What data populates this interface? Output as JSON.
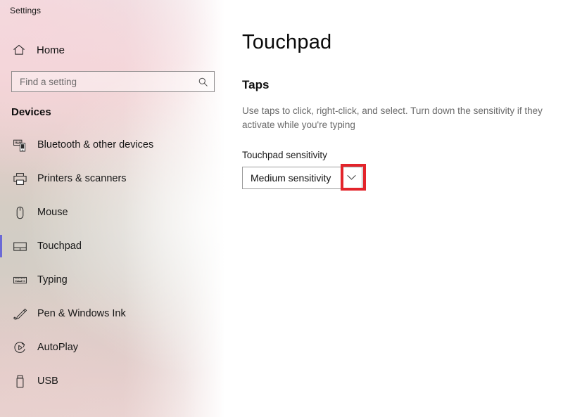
{
  "window": {
    "app_title": "Settings"
  },
  "sidebar": {
    "home": {
      "label": "Home",
      "icon": "home-icon"
    },
    "search": {
      "value": "",
      "placeholder": "Find a setting",
      "icon": "search-icon"
    },
    "category_title": "Devices",
    "items": [
      {
        "label": "Bluetooth & other devices",
        "icon": "bluetooth-devices-icon",
        "selected": false
      },
      {
        "label": "Printers & scanners",
        "icon": "printer-icon",
        "selected": false
      },
      {
        "label": "Mouse",
        "icon": "mouse-icon",
        "selected": false
      },
      {
        "label": "Touchpad",
        "icon": "touchpad-icon",
        "selected": true
      },
      {
        "label": "Typing",
        "icon": "keyboard-icon",
        "selected": false
      },
      {
        "label": "Pen & Windows Ink",
        "icon": "pen-icon",
        "selected": false
      },
      {
        "label": "AutoPlay",
        "icon": "autoplay-icon",
        "selected": false
      },
      {
        "label": "USB",
        "icon": "usb-icon",
        "selected": false
      }
    ]
  },
  "main": {
    "page_title": "Touchpad",
    "section_title": "Taps",
    "section_description": "Use taps to click, right-click, and select. Turn down the sensitivity if they activate while you're typing",
    "field_label": "Touchpad sensitivity",
    "sensitivity": {
      "selected": "Medium sensitivity",
      "arrow_icon": "chevron-down-icon"
    }
  },
  "annotation": {
    "highlight_color": "#e3242b",
    "target": "sensitivity-dropdown-arrow"
  },
  "colors": {
    "accent": "#6b69d6",
    "highlight_red": "#e3242b",
    "content_background": "#ffffff",
    "muted_text": "#6a6a6a"
  }
}
